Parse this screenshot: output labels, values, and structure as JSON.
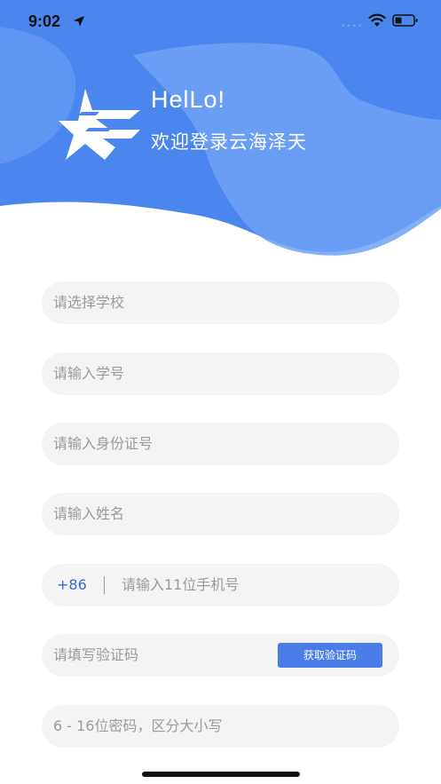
{
  "status_bar": {
    "time": "9:02",
    "icons": [
      "location-arrow-icon",
      "wifi-icon",
      "battery-icon"
    ]
  },
  "header": {
    "hello": "HelLo!",
    "welcome": "欢迎登录云海泽天",
    "logo": "star-z-logo",
    "colors": {
      "primary": "#4a86ee",
      "secondary": "#6ea2f4"
    }
  },
  "form": {
    "school": {
      "placeholder": "请选择学校"
    },
    "student_id": {
      "placeholder": "请输入学号"
    },
    "id_card": {
      "placeholder": "请输入身份证号"
    },
    "name": {
      "placeholder": "请输入姓名"
    },
    "phone": {
      "prefix": "+86",
      "placeholder": "请输入11位手机号"
    },
    "verify_code": {
      "placeholder": "请填写验证码",
      "button_label": "获取验证码"
    },
    "password": {
      "placeholder": "6 - 16位密码，区分大小写"
    }
  }
}
